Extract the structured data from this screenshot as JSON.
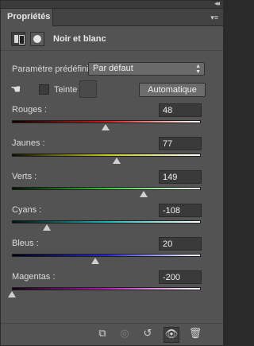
{
  "tab": {
    "label": "Propriétés"
  },
  "header": {
    "title": "Noir et blanc"
  },
  "preset": {
    "label": "Paramètre prédéfini :",
    "value": "Par défaut"
  },
  "tint": {
    "label": "Teinte",
    "checked": false
  },
  "auto_button": "Automatique",
  "sliders": [
    {
      "label": "Rouges :",
      "value": "48",
      "min": -200,
      "max": 300,
      "colors": [
        "#140000",
        "#c81e1e",
        "#ffffff"
      ]
    },
    {
      "label": "Jaunes :",
      "value": "77",
      "min": -200,
      "max": 300,
      "colors": [
        "#111100",
        "#c8c81e",
        "#ffffff"
      ]
    },
    {
      "label": "Verts :",
      "value": "149",
      "min": -200,
      "max": 300,
      "colors": [
        "#001400",
        "#3cc83c",
        "#ffffff"
      ]
    },
    {
      "label": "Cyans :",
      "value": "-108",
      "min": -200,
      "max": 300,
      "colors": [
        "#001212",
        "#1eb4b4",
        "#ffffff"
      ]
    },
    {
      "label": "Bleus :",
      "value": "20",
      "min": -200,
      "max": 300,
      "colors": [
        "#000014",
        "#2828d2",
        "#ffffff"
      ]
    },
    {
      "label": "Magentas :",
      "value": "-200",
      "min": -200,
      "max": 300,
      "colors": [
        "#140014",
        "#b41eb4",
        "#ffffff"
      ]
    }
  ],
  "icons": {
    "adjustment": "adjustment-layer-icon",
    "mask": "mask-icon",
    "hand": "targeted-adjustment-hand-icon",
    "clip": "clip-to-layer-icon",
    "view_previous": "view-previous-state-icon",
    "reset": "reset-icon",
    "visibility": "eye-icon",
    "delete": "trash-icon"
  }
}
